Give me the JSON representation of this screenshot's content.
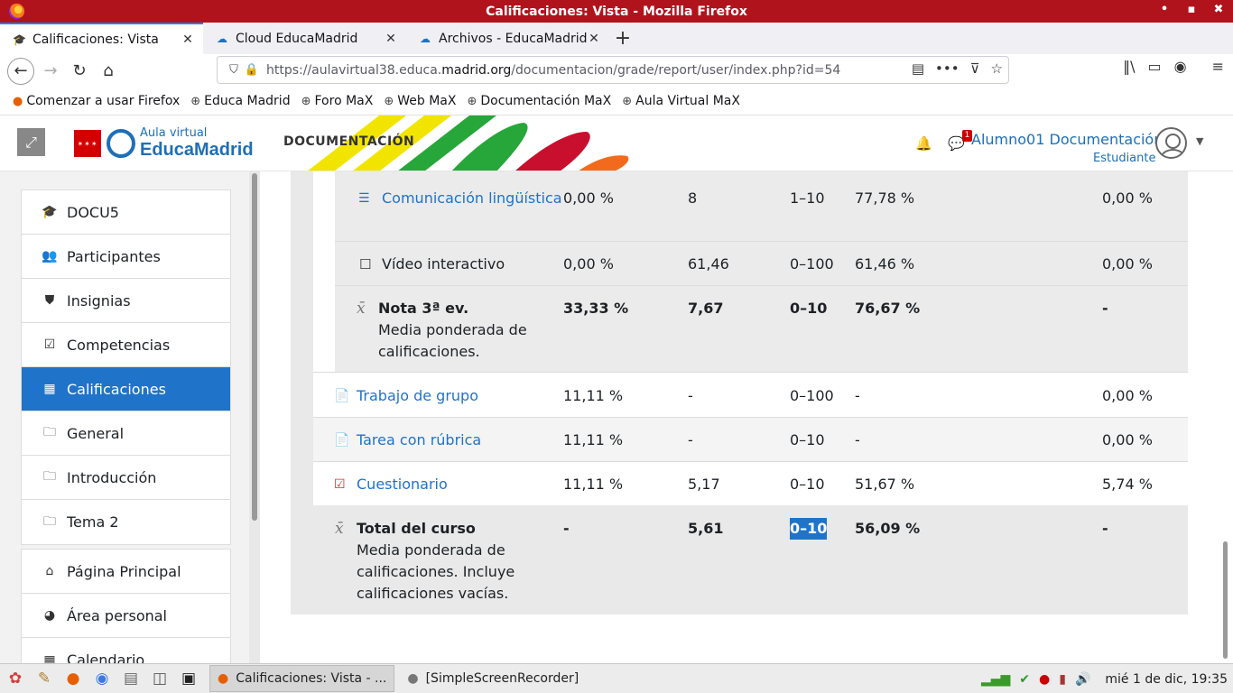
{
  "window": {
    "title": "Calificaciones: Vista - Mozilla Firefox",
    "controls": [
      "•",
      "▪",
      "✖"
    ]
  },
  "tabs": [
    {
      "label": "Calificaciones: Vista",
      "close": "✕"
    },
    {
      "label": "Cloud EducaMadrid",
      "close": "✕"
    },
    {
      "label": "Archivos - EducaMadrid",
      "close": "✕"
    }
  ],
  "new_tab": "+",
  "nav": {
    "back": "←",
    "forward": "→",
    "reload": "↻",
    "home": "⌂"
  },
  "url": {
    "prefix": "https://aulavirtual38.educa.",
    "domain": "madrid.org",
    "path": "/documentacion/grade/report/user/index.php?id=54"
  },
  "bookmarks": [
    "Comenzar a usar Firefox",
    "Educa Madrid",
    "Foro MaX",
    "Web MaX",
    "Documentación MaX",
    "Aula Virtual MaX"
  ],
  "header": {
    "logo_sub": "Aula virtual",
    "logo_main": "EducaMadrid",
    "course_label": "DOCUMENTACIÓN",
    "notification_count": "1",
    "user_name": "Alumno01 Documentación",
    "user_role": "Estudiante"
  },
  "drawer": {
    "course_items": [
      {
        "label": "DOCU5",
        "icon": "graduation-cap-icon"
      },
      {
        "label": "Participantes",
        "icon": "users-icon"
      },
      {
        "label": "Insignias",
        "icon": "shield-icon"
      },
      {
        "label": "Competencias",
        "icon": "check-square-icon"
      },
      {
        "label": "Calificaciones",
        "icon": "table-icon"
      },
      {
        "label": "General",
        "icon": "folder-icon"
      },
      {
        "label": "Introducción",
        "icon": "folder-icon"
      },
      {
        "label": "Tema 2",
        "icon": "folder-icon"
      }
    ],
    "site_items": [
      {
        "label": "Página Principal",
        "icon": "home-icon"
      },
      {
        "label": "Área personal",
        "icon": "dashboard-icon"
      },
      {
        "label": "Calendario",
        "icon": "calendar-icon"
      }
    ]
  },
  "grades": {
    "rows": [
      {
        "item": "Comunicación lingüística",
        "item_line2": "",
        "weight": "0,00 %",
        "grade": "8",
        "range": "1–10",
        "percent": "77,78 %",
        "contribution": "0,00 %"
      },
      {
        "item": "Vídeo interactivo",
        "weight": "0,00 %",
        "grade": "61,46",
        "range": "0–100",
        "percent": "61,46 %",
        "contribution": "0,00 %"
      },
      {
        "item": "Nota 3ª ev.",
        "desc1": "Media ponderada de",
        "desc2": "calificaciones.",
        "weight": "33,33 %",
        "grade": "7,67",
        "range": "0–10",
        "percent": "76,67 %",
        "contribution": "-"
      },
      {
        "item": "Trabajo de grupo",
        "weight": "11,11 %",
        "grade": "-",
        "range": "0–100",
        "percent": "-",
        "contribution": "0,00 %"
      },
      {
        "item": "Tarea con rúbrica",
        "weight": "11,11 %",
        "grade": "-",
        "range": "0–10",
        "percent": "-",
        "contribution": "0,00 %"
      },
      {
        "item": "Cuestionario",
        "weight": "11,11 %",
        "grade": "5,17",
        "range": "0–10",
        "percent": "51,67 %",
        "contribution": "5,74 %"
      },
      {
        "item": "Total del curso",
        "desc1": "Media ponderada de",
        "desc2": "calificaciones. Incluye",
        "desc3": "calificaciones vacías.",
        "weight": "-",
        "grade": "5,61",
        "range": "0–10",
        "percent": "56,09 %",
        "contribution": "-"
      }
    ]
  },
  "taskbar": {
    "tasks": [
      "Calificaciones: Vista - ...",
      "[SimpleScreenRecorder]"
    ],
    "clock": "mié  1 de dic, 19:35"
  }
}
